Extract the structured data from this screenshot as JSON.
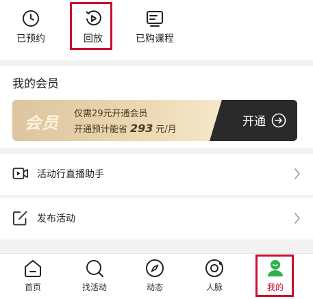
{
  "quick_actions": [
    {
      "label": "已预约",
      "icon": "clock-icon"
    },
    {
      "label": "回放",
      "icon": "replay-icon",
      "highlighted": true
    },
    {
      "label": "已购课程",
      "icon": "course-icon"
    }
  ],
  "member": {
    "section_title": "我的会员",
    "logo_text": "会员",
    "promo_line1": "仅需29元开通会员",
    "promo_line2_prefix": "开通预计能省",
    "promo_amount": "293",
    "promo_line2_suffix": "元/月",
    "open_label": "开通"
  },
  "menu": [
    {
      "label": "活动行直播助手",
      "icon": "video-icon"
    },
    {
      "label": "发布活动",
      "icon": "edit-icon"
    }
  ],
  "nav": [
    {
      "label": "首页",
      "icon": "home-icon"
    },
    {
      "label": "找活动",
      "icon": "search-icon"
    },
    {
      "label": "动态",
      "icon": "compass-icon"
    },
    {
      "label": "人脉",
      "icon": "network-icon"
    },
    {
      "label": "我的",
      "icon": "profile-icon",
      "active": true
    }
  ],
  "colors": {
    "accent": "#c8102e",
    "brand_green": "#2bb24c",
    "gold": "#e9d3a8",
    "dark": "#2a2a2a"
  }
}
